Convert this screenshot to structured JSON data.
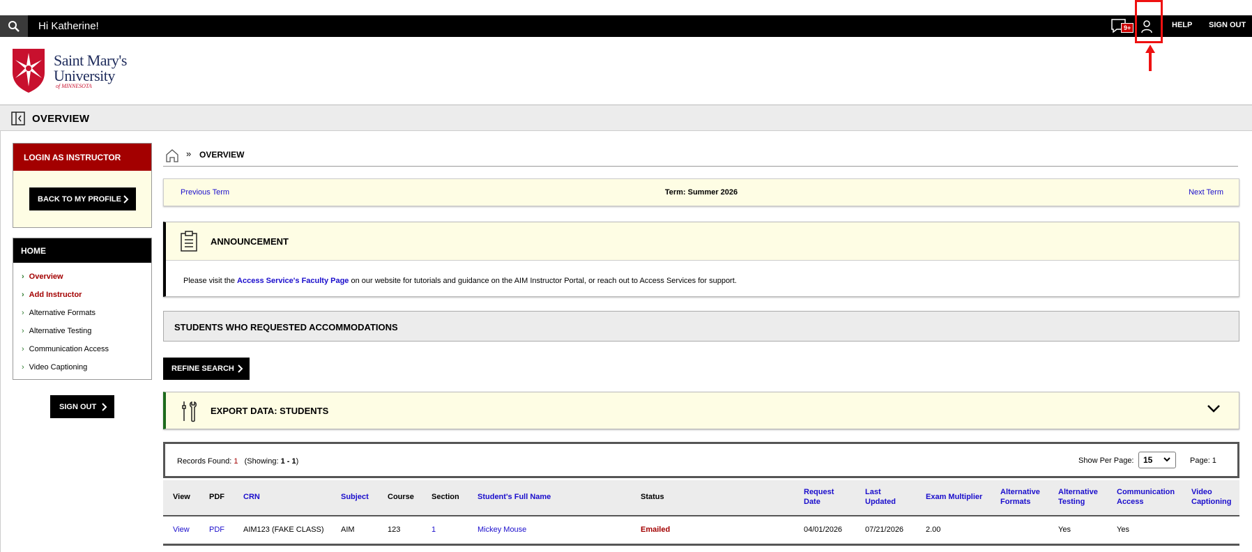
{
  "topbar": {
    "greeting": "Hi Katherine!",
    "message_badge": "9+",
    "help_label": "HELP",
    "signout_label": "SIGN OUT"
  },
  "logo": {
    "line1": "Saint Mary's",
    "line2": "University",
    "line3": "of MINNESOTA",
    "brand_color": "#c8102e"
  },
  "page": {
    "title": "OVERVIEW"
  },
  "sidebar": {
    "login_as_header": "LOGIN AS INSTRUCTOR",
    "back_button": "BACK TO MY PROFILE",
    "home_header": "HOME",
    "items": [
      {
        "label": "Overview"
      },
      {
        "label": "Add Instructor"
      },
      {
        "label": "Alternative Formats"
      },
      {
        "label": "Alternative Testing"
      },
      {
        "label": "Communication Access"
      },
      {
        "label": "Video Captioning"
      }
    ],
    "signout_button": "SIGN OUT"
  },
  "breadcrumb": {
    "current": "OVERVIEW"
  },
  "term": {
    "previous": "Previous Term",
    "current": "Term: Summer 2026",
    "next": "Next Term"
  },
  "announcement": {
    "title": "ANNOUNCEMENT",
    "text_before": "Please visit the ",
    "link": "Access Service's Faculty Page",
    "text_after": " on our website for tutorials and guidance on the AIM Instructor Portal, or reach out to Access Services for support."
  },
  "students_section": {
    "title": "STUDENTS WHO REQUESTED ACCOMMODATIONS",
    "refine_button": "REFINE SEARCH",
    "export_title": "EXPORT DATA: STUDENTS"
  },
  "records": {
    "found_label": "Records Found:",
    "found_count": "1",
    "showing_prefix": "(Showing:",
    "showing_range": "1 - 1",
    "showing_suffix": ")",
    "per_page_label": "Show Per Page:",
    "per_page_value": "15",
    "page_label": "Page: 1"
  },
  "table": {
    "headers": {
      "view": "View",
      "pdf": "PDF",
      "crn": "CRN",
      "subject": "Subject",
      "course": "Course",
      "section": "Section",
      "student": "Student's Full Name",
      "status": "Status",
      "request_date_1": "Request",
      "request_date_2": "Date",
      "last_updated_1": "Last",
      "last_updated_2": "Updated",
      "exam_multiplier": "Exam Multiplier",
      "alt_formats_1": "Alternative",
      "alt_formats_2": "Formats",
      "alt_testing_1": "Alternative",
      "alt_testing_2": "Testing",
      "comm_access_1": "Communication",
      "comm_access_2": "Access",
      "video_cap_1": "Video",
      "video_cap_2": "Captioning"
    },
    "rows": [
      {
        "view": "View",
        "pdf": "PDF",
        "crn": "AIM123 (FAKE CLASS)",
        "subject": "AIM",
        "course": "123",
        "section": "1",
        "student": "Mickey Mouse",
        "status": "Emailed",
        "request_date": "04/01/2026",
        "last_updated": "07/21/2026",
        "exam_multiplier": "2.00",
        "alt_formats": "",
        "alt_testing": "Yes",
        "comm_access": "Yes",
        "video_cap": ""
      }
    ]
  }
}
